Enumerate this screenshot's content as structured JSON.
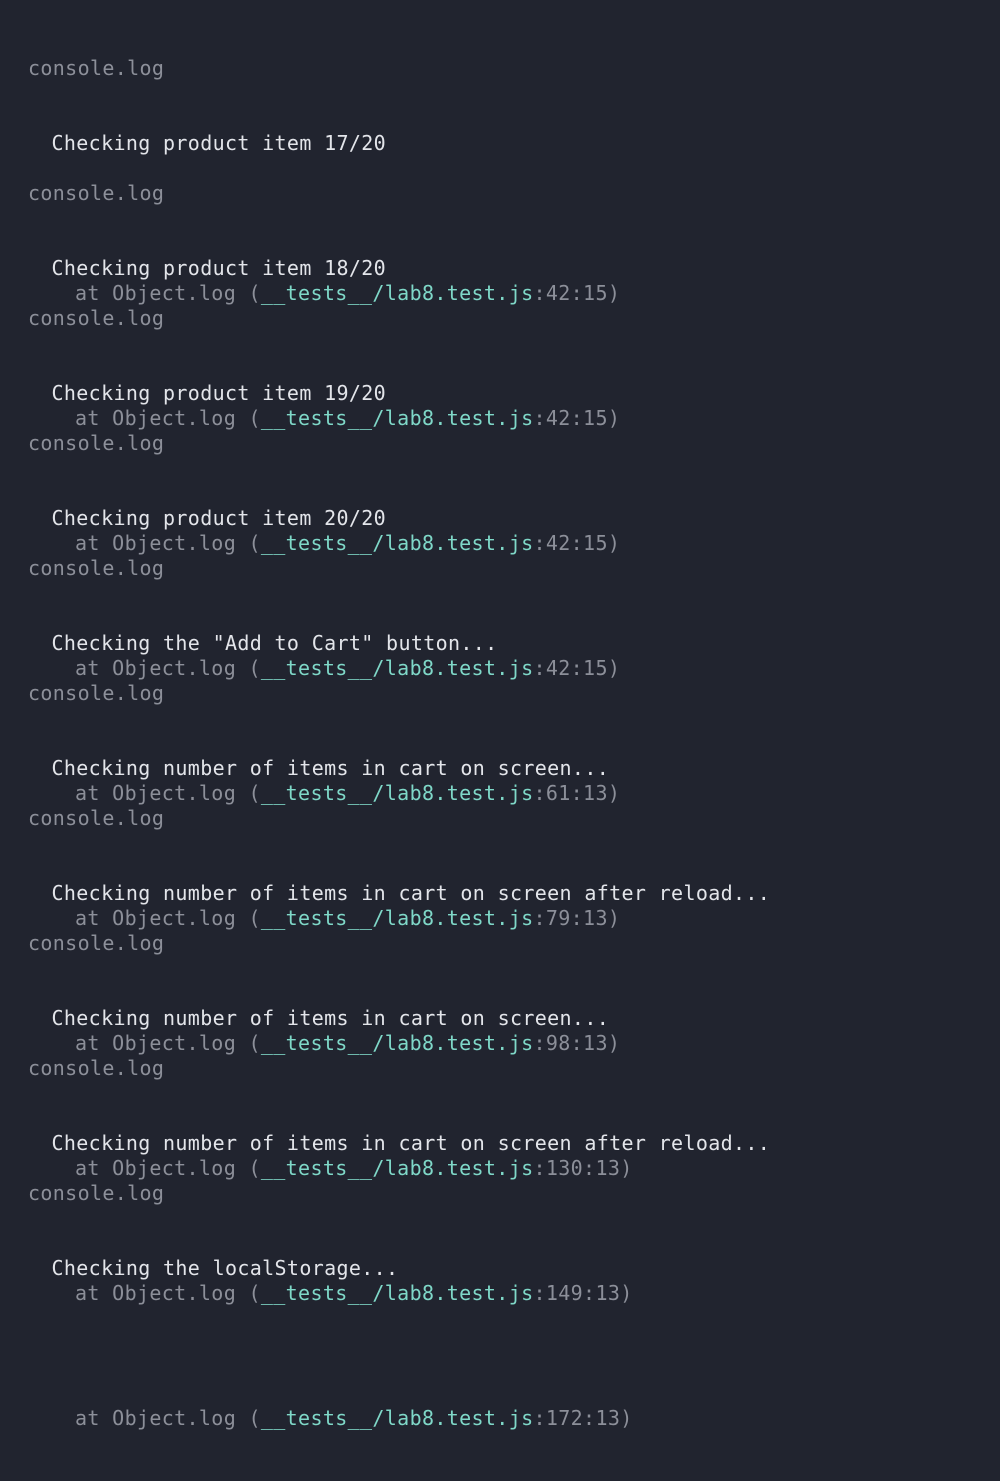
{
  "terminal": {
    "entries": [
      {
        "label": "console.log",
        "message": "Checking product item 17/20",
        "trace_prefix": "at Object.log (",
        "trace_file": "__tests__/lab8.test.js",
        "trace_position": ":42:15)"
      },
      {
        "label": "console.log",
        "message": "Checking product item 18/20",
        "trace_prefix": "at Object.log (",
        "trace_file": "__tests__/lab8.test.js",
        "trace_position": ":42:15)"
      },
      {
        "label": "console.log",
        "message": "Checking product item 19/20",
        "trace_prefix": "at Object.log (",
        "trace_file": "__tests__/lab8.test.js",
        "trace_position": ":42:15)"
      },
      {
        "label": "console.log",
        "message": "Checking product item 20/20",
        "trace_prefix": "at Object.log (",
        "trace_file": "__tests__/lab8.test.js",
        "trace_position": ":42:15)"
      },
      {
        "label": "console.log",
        "message": "Checking the \"Add to Cart\" button...",
        "trace_prefix": "at Object.log (",
        "trace_file": "__tests__/lab8.test.js",
        "trace_position": ":61:13)"
      },
      {
        "label": "console.log",
        "message": "Checking number of items in cart on screen...",
        "trace_prefix": "at Object.log (",
        "trace_file": "__tests__/lab8.test.js",
        "trace_position": ":79:13)"
      },
      {
        "label": "console.log",
        "message": "Checking number of items in cart on screen after reload...",
        "trace_prefix": "at Object.log (",
        "trace_file": "__tests__/lab8.test.js",
        "trace_position": ":98:13)"
      },
      {
        "label": "console.log",
        "message": "Checking number of items in cart on screen...",
        "trace_prefix": "at Object.log (",
        "trace_file": "__tests__/lab8.test.js",
        "trace_position": ":130:13)"
      },
      {
        "label": "console.log",
        "message": "Checking number of items in cart on screen after reload...",
        "trace_prefix": "at Object.log (",
        "trace_file": "__tests__/lab8.test.js",
        "trace_position": ":149:13)"
      },
      {
        "label": "console.log",
        "message": "Checking the localStorage...",
        "trace_prefix": "at Object.log (",
        "trace_file": "__tests__/lab8.test.js",
        "trace_position": ":172:13)"
      }
    ]
  },
  "colors": {
    "background": "#21242f",
    "label": "#8c8f99",
    "message": "#e3e5ea",
    "file_link": "#7fd8c8"
  }
}
